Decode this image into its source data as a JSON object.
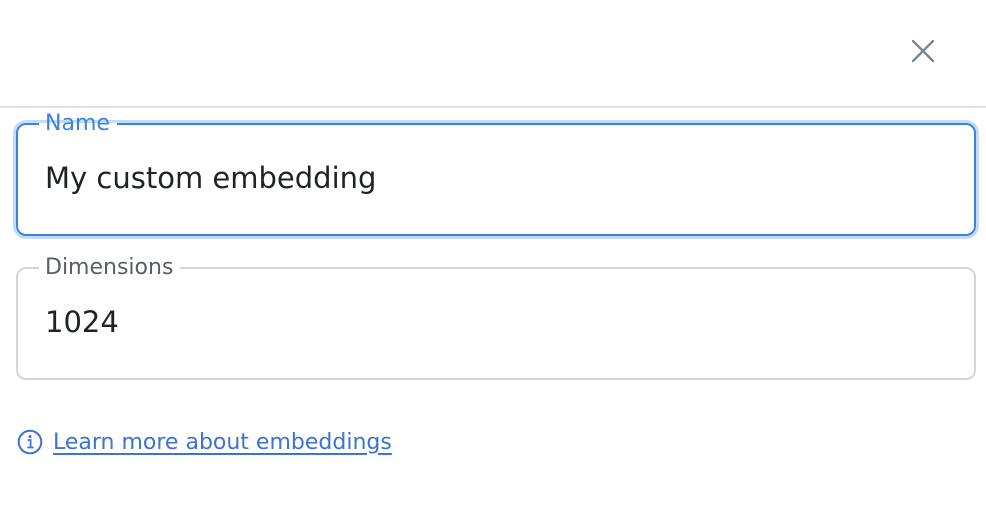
{
  "dialog": {
    "close_icon": "close-icon",
    "accent_color": "#3b82e6"
  },
  "name_field": {
    "label": "Name",
    "value": "My custom embedding"
  },
  "dimensions_field": {
    "label": "Dimensions",
    "value": "1024"
  },
  "learn_more": {
    "icon": "info-icon",
    "text": "Learn more about embeddings",
    "link_color": "#3b73d6"
  }
}
